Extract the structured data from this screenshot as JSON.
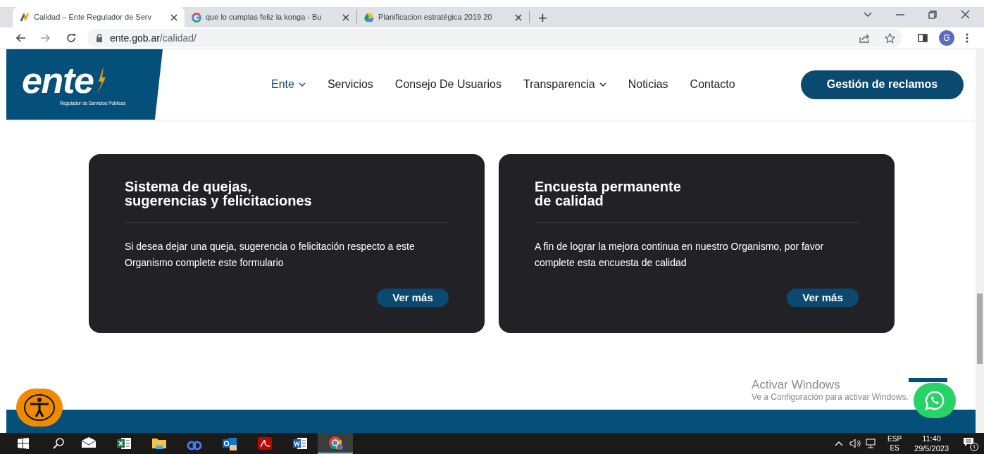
{
  "browser": {
    "tabs": [
      {
        "title": "Calidad – Ente Regulador de Serv",
        "selected": true
      },
      {
        "title": "que lo cumplas feliz la konga - Bu",
        "selected": false
      },
      {
        "title": "Planificacion estratégica 2019 20",
        "selected": false
      }
    ],
    "new_tab": "+",
    "address": {
      "domain": "ente.gob.ar",
      "path": "/calidad/"
    },
    "profile": "G"
  },
  "header": {
    "logo": {
      "wordmark": "ente",
      "tagline": "Regulador de Servicios Públicos"
    },
    "nav": [
      {
        "label": "Ente",
        "dropdown": true
      },
      {
        "label": "Servicios",
        "dropdown": false
      },
      {
        "label": "Consejo De Usuarios",
        "dropdown": false
      },
      {
        "label": "Transparencia",
        "dropdown": true
      },
      {
        "label": "Noticias",
        "dropdown": false
      },
      {
        "label": "Contacto",
        "dropdown": false
      }
    ],
    "cta": "Gestión de reclamos"
  },
  "cards": [
    {
      "title": "Sistema de quejas,\nsugerencias y felicitaciones",
      "body": "Si desea dejar una queja, sugerencia o felicitación respecto a este Organismo complete este formulario",
      "button": "Ver más"
    },
    {
      "title": "Encuesta permanente\nde calidad",
      "body": "A fin de lograr la mejora continua en nuestro Organismo, por favor complete esta encuesta de calidad",
      "button": "Ver más"
    }
  ],
  "activation_notice": {
    "title": "Activar Windows",
    "subtitle": "Ve a Configuración para activar Windows."
  },
  "taskbar": {
    "apps": [
      {
        "kind": "mail",
        "selected": false
      },
      {
        "kind": "excel",
        "selected": false
      },
      {
        "kind": "folder",
        "selected": false
      },
      {
        "kind": "loop",
        "selected": false
      },
      {
        "kind": "outlook",
        "selected": false
      },
      {
        "kind": "acrobat",
        "selected": false
      },
      {
        "kind": "word",
        "selected": false
      },
      {
        "kind": "chrome",
        "selected": true
      }
    ],
    "language": "ESP",
    "layout": "ES",
    "time": "11:40",
    "date": "29/5/2023",
    "notifications": "1"
  }
}
